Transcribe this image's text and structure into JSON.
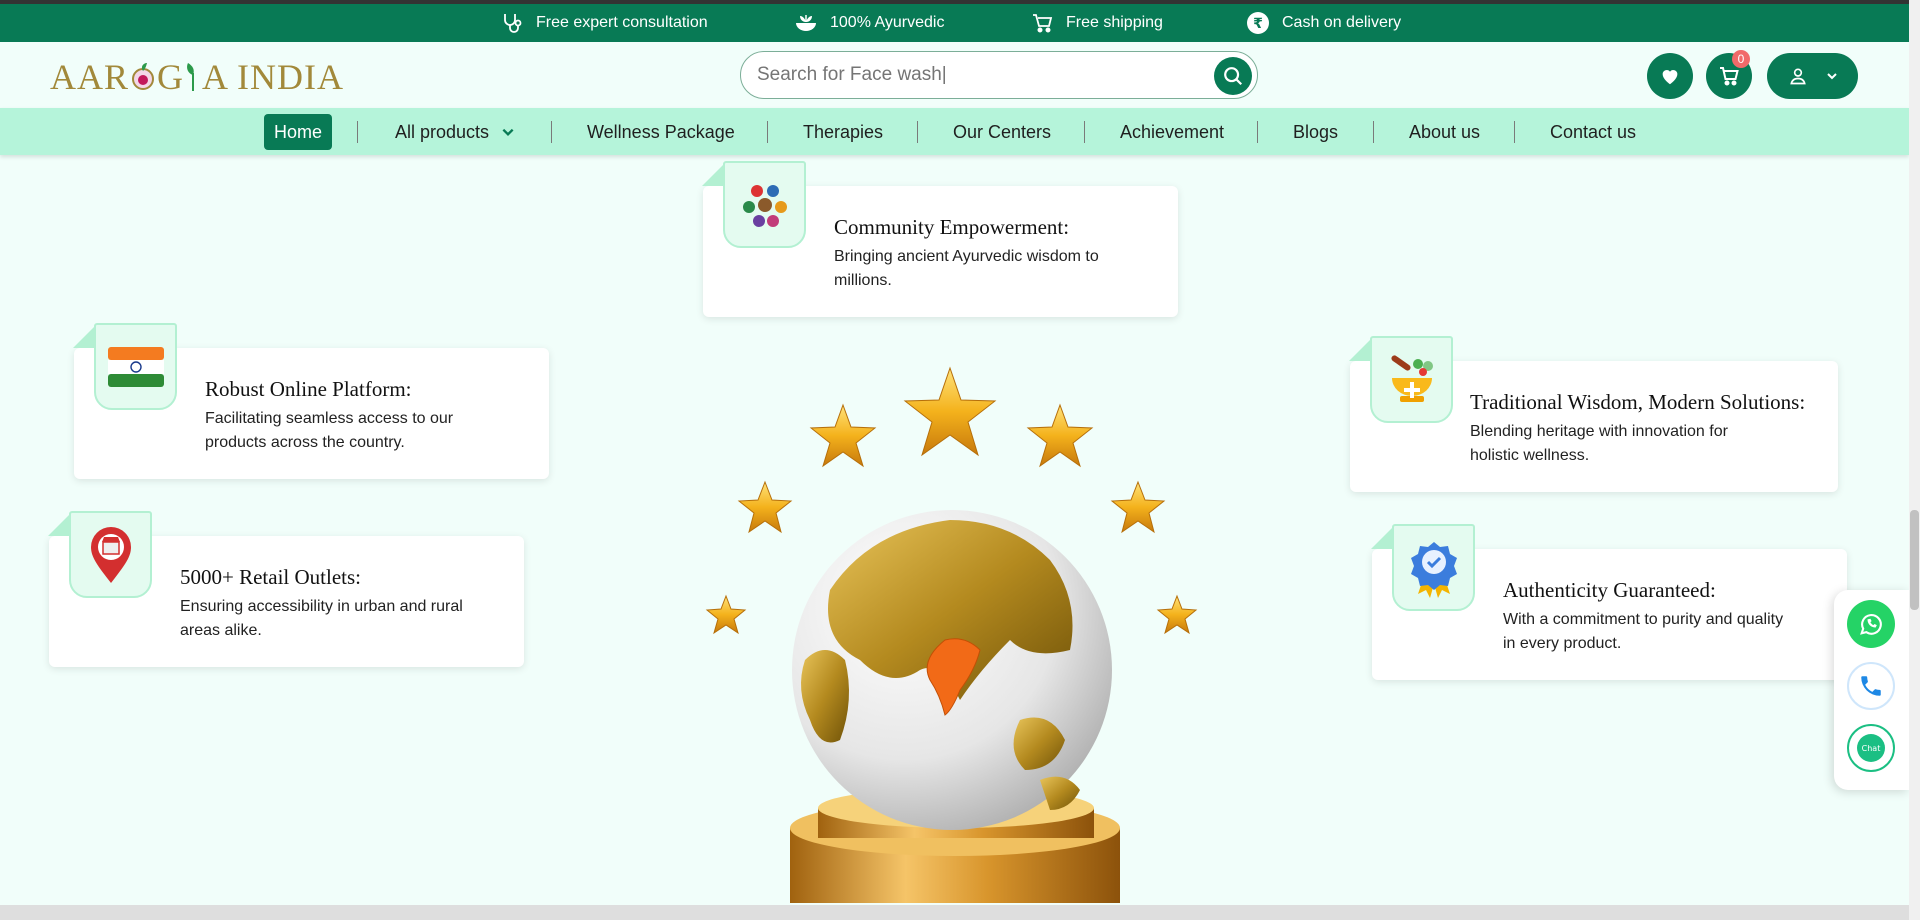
{
  "promo": {
    "items": [
      {
        "label": "Free expert consultation",
        "icon": "stethoscope-icon"
      },
      {
        "label": "100% Ayurvedic",
        "icon": "herbal-bowl-icon"
      },
      {
        "label": "Free shipping",
        "icon": "shipping-cart-icon"
      },
      {
        "label": "Cash on delivery",
        "icon": "rupee-icon"
      }
    ]
  },
  "header": {
    "logo": {
      "before": "AAR",
      "middle": "G",
      "after": "A INDIA"
    },
    "search": {
      "placeholder": "Search for Face wash|"
    },
    "cart_count": "0"
  },
  "nav": {
    "items": [
      "Home",
      "All products",
      "Wellness Package",
      "Therapies",
      "Our Centers",
      "Achievement",
      "Blogs",
      "About us",
      "Contact us"
    ]
  },
  "features": [
    {
      "title": "Community Empowerment:",
      "desc": "Bringing ancient Ayurvedic wisdom to millions.",
      "icon": "community-icon"
    },
    {
      "title": "Robust Online Platform:",
      "desc": "Facilitating seamless access to our products across the country.",
      "icon": "india-flag-icon"
    },
    {
      "title": "Traditional Wisdom, Modern Solutions:",
      "desc": "Blending heritage with innovation for holistic wellness.",
      "icon": "mortar-pestle-icon"
    },
    {
      "title": "5000+ Retail Outlets:",
      "desc": "Ensuring accessibility in urban and rural areas alike.",
      "icon": "store-location-icon"
    },
    {
      "title": "Authenticity Guaranteed:",
      "desc": "With a commitment to purity and quality in every product.",
      "icon": "verified-badge-icon"
    }
  ],
  "floating": {
    "chat_label": "Chat"
  },
  "colors": {
    "primary": "#087a55",
    "nav_bg": "#b5f4da",
    "page_bg": "#f1fefa",
    "gold": "#a2893a"
  }
}
